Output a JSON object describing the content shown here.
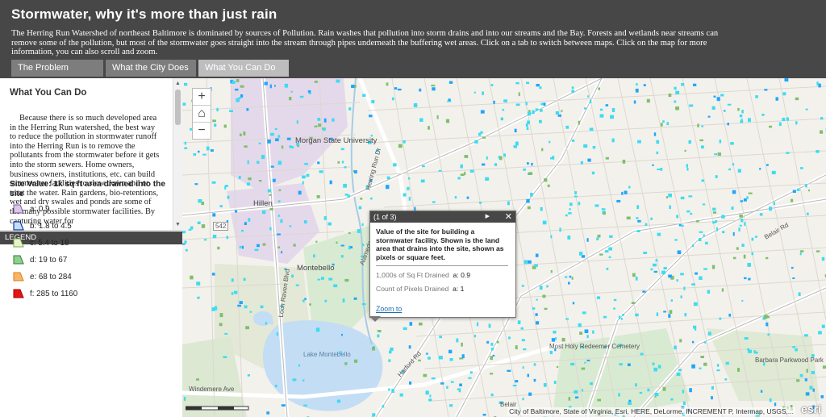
{
  "header": {
    "title": "Stormwater, why it's more than just rain",
    "intro": "The Herring Run Watershed of northeast Baltimore is dominated by sources of Pollution. Rain washes that pollution into storm drains and into our streams and the Bay. Forests and wetlands near streams can remove some of the pollution, but most of the stormwater goes straight into the stream through pipes underneath the buffering wet areas. Click on a tab to switch between maps. Click on the map for more information, you can also scroll and zoom."
  },
  "tabs": [
    {
      "label": "The Problem",
      "active": false
    },
    {
      "label": "What the City Does",
      "active": false
    },
    {
      "label": "What You Can Do",
      "active": true
    }
  ],
  "story": {
    "heading": "What You Can Do",
    "body": "Because there is so much developed area in the Herring Run watershed, the best way to reduce the pollution in stormwater runoff into the Herring Run is to remove the pollutants from the stormwater before it gets into the storm sewers.  Home owners, business owners, institutions, etc. can build stormwater facilities to slow down and or treat the water.  Rain gardens, bio-retentions, wet and dry swales and ponds are some of the many possible stormwater facilities.  By capturing water for"
  },
  "legend": {
    "bar_label": "LEGEND",
    "title": "Site Value: 1k sq ft area drained into the site",
    "items": [
      {
        "label": "a: 0.9",
        "fill": "#dcc6ea",
        "stroke": "#7d5d9b"
      },
      {
        "label": "b: 1.8 to 4.5",
        "fill": "#bfe0f7",
        "stroke": "#1737a3"
      },
      {
        "label": "c: 5.4 to 18",
        "fill": "#e6f5c9",
        "stroke": "#76a84a"
      },
      {
        "label": "d: 19 to 67",
        "fill": "#8fcf8f",
        "stroke": "#2e7d32"
      },
      {
        "label": "e: 68 to 284",
        "fill": "#f7b56a",
        "stroke": "#e07a16"
      },
      {
        "label": "f: 285 to 1160",
        "fill": "#e31414",
        "stroke": "#a80000"
      }
    ]
  },
  "map": {
    "zoom_in": "+",
    "home": "⌂",
    "zoom_out": "−",
    "labels": [
      "Morgan State University",
      "Hillen",
      "Montebello",
      "Lake Montebello",
      "Most Holy Redeemer Cemetery",
      "Barbara Parkwood Park",
      "Belair",
      "Harford Rd",
      "Loch Raven Blvd",
      "Alameda",
      "Belair Rd",
      "Herring Run Dr",
      "Windemere Ave",
      "542"
    ],
    "attribution": "City of Baltimore, State of Virginia, Esri, HERE, DeLorme, INCREMENT P, Intermap, USGS,...",
    "esri": "esri",
    "colors": {
      "site_points": "#3ddcf0",
      "parcel_blue": "#1ea6ff",
      "road": "#ffffff",
      "water": "#c3ddf4",
      "campus": "#e2d6ea"
    }
  },
  "popup": {
    "counter": "(1 of 3)",
    "next_symbol": "▶",
    "close_symbol": "✕",
    "description": "Value of the site for building a stormwater facility. Shown is the land area that drains into the site, shown as pixels or square feet.",
    "rows": [
      {
        "label": "1,000s of Sq Ft Drained",
        "value": "a: 0.9"
      },
      {
        "label": "Count of Pixels Drained",
        "value": "a: 1"
      }
    ],
    "zoom_link": "Zoom to"
  }
}
